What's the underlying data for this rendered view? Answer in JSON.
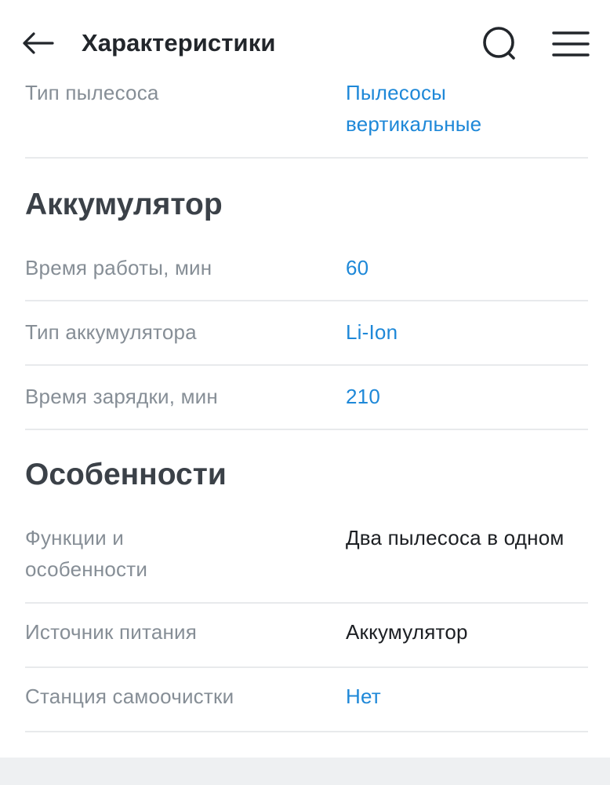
{
  "header": {
    "title": "Характеристики",
    "back_icon": "arrow-left-icon",
    "search_icon": "search-icon",
    "menu_icon": "hamburger-menu-icon"
  },
  "colors": {
    "link": "#1e88d8",
    "label": "#868e96",
    "divider": "#e8eaec",
    "footer": "#eef0f2"
  },
  "partial_row": {
    "label": "Тип пылесоса",
    "value_line1": "Пылесосы",
    "value_line2": "вертикальные"
  },
  "sections": [
    {
      "title": "Аккумулятор",
      "rows": [
        {
          "label": "Время работы, мин",
          "value": "60"
        },
        {
          "label": "Тип аккумулятора",
          "value": "Li-Ion"
        },
        {
          "label": "Время зарядки, мин",
          "value": "210"
        }
      ]
    },
    {
      "title": "Особенности",
      "rows": [
        {
          "label_line1": "Функции и",
          "label_line2": "особенности",
          "value": "Два пылесоса в одном"
        },
        {
          "label": "Источник питания",
          "value": "Аккумулятор"
        },
        {
          "label": "Станция самоочистки",
          "value": "Нет"
        }
      ]
    }
  ]
}
